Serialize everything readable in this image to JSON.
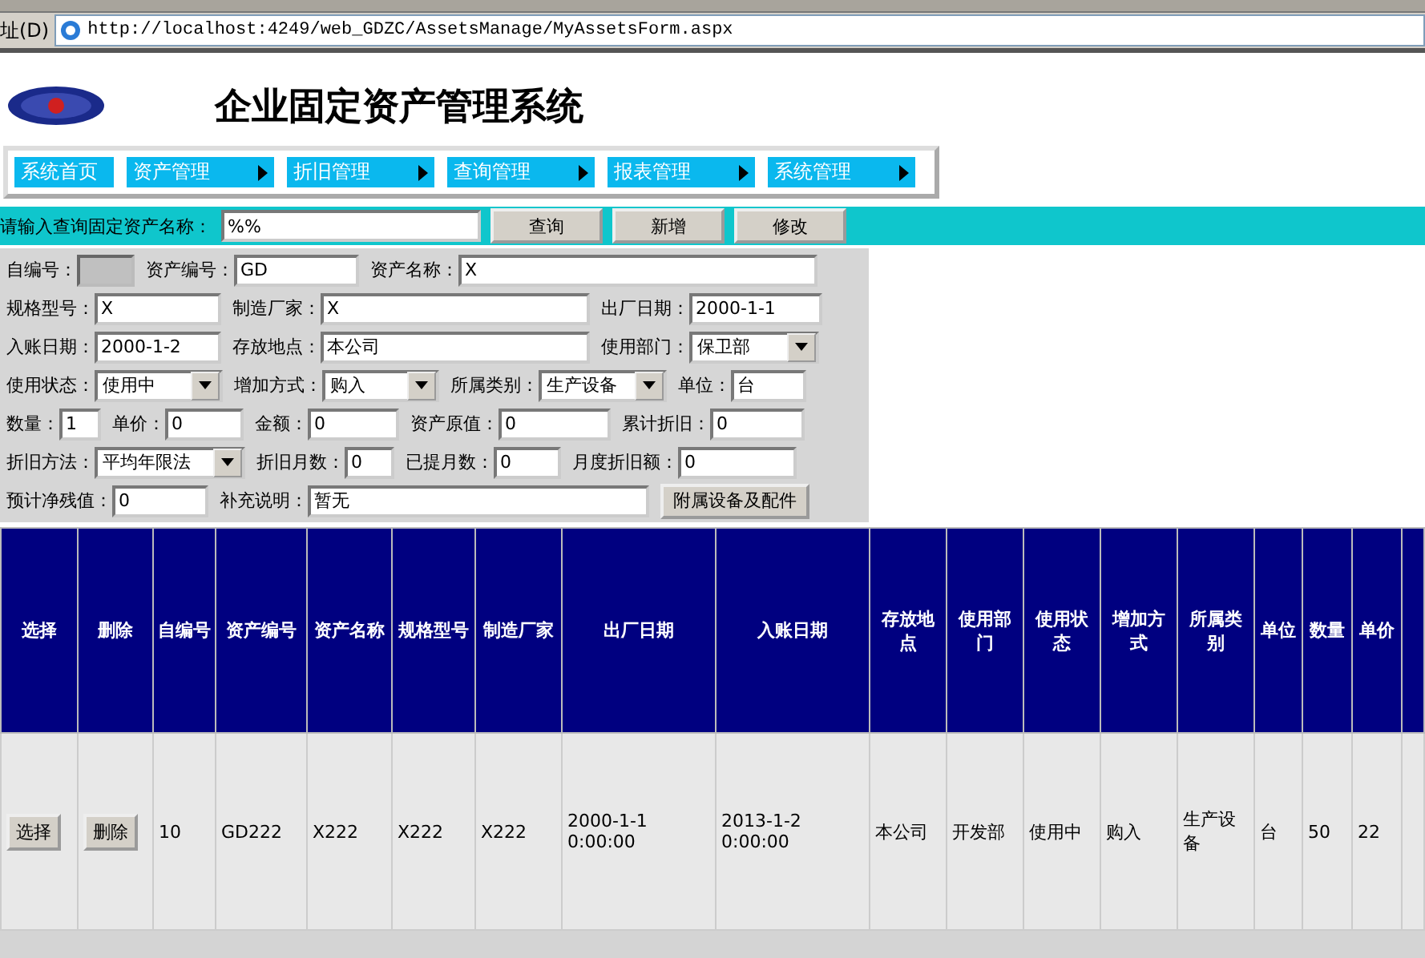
{
  "address_bar": {
    "label": "址(D)",
    "url": "http://localhost:4249/web_GDZC/AssetsManage/MyAssetsForm.aspx"
  },
  "header": {
    "title": "企业固定资产管理系统"
  },
  "nav": [
    {
      "label": "系统首页",
      "submenu": false
    },
    {
      "label": "资产管理",
      "submenu": true
    },
    {
      "label": "折旧管理",
      "submenu": true
    },
    {
      "label": "查询管理",
      "submenu": true
    },
    {
      "label": "报表管理",
      "submenu": true
    },
    {
      "label": "系统管理",
      "submenu": true
    }
  ],
  "search": {
    "label": "请输入查询固定资产名称：",
    "value": "%%",
    "buttons": [
      "查询",
      "新增",
      "修改"
    ]
  },
  "form": [
    [
      {
        "kind": "readonly",
        "label": "自编号："
      },
      {
        "kind": "text",
        "label": "资产编号：",
        "value": "GD"
      },
      {
        "kind": "text",
        "label": "资产名称：",
        "value": "X"
      }
    ],
    [
      {
        "kind": "text",
        "label": "规格型号：",
        "value": "X"
      },
      {
        "kind": "text",
        "label": "制造厂家：",
        "value": "X"
      },
      {
        "kind": "text",
        "label": "出厂日期：",
        "value": "2000-1-1"
      }
    ],
    [
      {
        "kind": "text",
        "label": "入账日期：",
        "value": "2000-1-2"
      },
      {
        "kind": "text",
        "label": "存放地点：",
        "value": "本公司"
      },
      {
        "kind": "select",
        "label": "使用部门：",
        "value": "保卫部"
      }
    ],
    [
      {
        "kind": "select",
        "label": "使用状态：",
        "value": "使用中"
      },
      {
        "kind": "select",
        "label": "增加方式：",
        "value": "购入"
      },
      {
        "kind": "select",
        "label": "所属类别：",
        "value": "生产设备"
      },
      {
        "kind": "text",
        "label": "单位：",
        "value": "台"
      }
    ],
    [
      {
        "kind": "text",
        "label": "数量：",
        "value": "1"
      },
      {
        "kind": "text",
        "label": "单价：",
        "value": "0"
      },
      {
        "kind": "text",
        "label": "金额：",
        "value": "0"
      },
      {
        "kind": "text",
        "label": "资产原值：",
        "value": "0"
      },
      {
        "kind": "text",
        "label": "累计折旧：",
        "value": "0"
      }
    ],
    [
      {
        "kind": "select",
        "label": "折旧方法：",
        "value": "平均年限法"
      },
      {
        "kind": "text",
        "label": "折旧月数：",
        "value": "0"
      },
      {
        "kind": "text",
        "label": "已提月数：",
        "value": "0"
      },
      {
        "kind": "text",
        "label": "月度折旧额：",
        "value": "0"
      }
    ],
    [
      {
        "kind": "text",
        "label": "预计净残值：",
        "value": "0"
      },
      {
        "kind": "text",
        "label": "补充说明：",
        "value": "暂无"
      },
      {
        "kind": "button",
        "value": "附属设备及配件"
      }
    ]
  ],
  "table": {
    "columns": [
      {
        "label": "选择",
        "kind": "action"
      },
      {
        "label": "删除",
        "kind": "action"
      },
      {
        "label": "自编号",
        "kind": "text"
      },
      {
        "label": "资产编号",
        "kind": "text"
      },
      {
        "label": "资产名称",
        "kind": "text"
      },
      {
        "label": "规格型号",
        "kind": "text"
      },
      {
        "label": "制造厂家",
        "kind": "text"
      },
      {
        "label": "出厂日期",
        "kind": "text"
      },
      {
        "label": "入账日期",
        "kind": "text"
      },
      {
        "label": "存放地点",
        "kind": "text"
      },
      {
        "label": "使用部门",
        "kind": "text"
      },
      {
        "label": "使用状态",
        "kind": "text"
      },
      {
        "label": "增加方式",
        "kind": "text"
      },
      {
        "label": "所属类别",
        "kind": "text"
      },
      {
        "label": "单位",
        "kind": "text"
      },
      {
        "label": "数量",
        "kind": "text"
      },
      {
        "label": "单价",
        "kind": "text"
      }
    ],
    "rows": [
      {
        "cells": [
          "选择",
          "删除",
          "10",
          "GD222",
          "X222",
          "X222",
          "X222",
          "2000-1-1 0:00:00",
          "2013-1-2 0:00:00",
          "本公司",
          "开发部",
          "使用中",
          "购入",
          "生产设备",
          "台",
          "50",
          "22"
        ]
      }
    ]
  }
}
